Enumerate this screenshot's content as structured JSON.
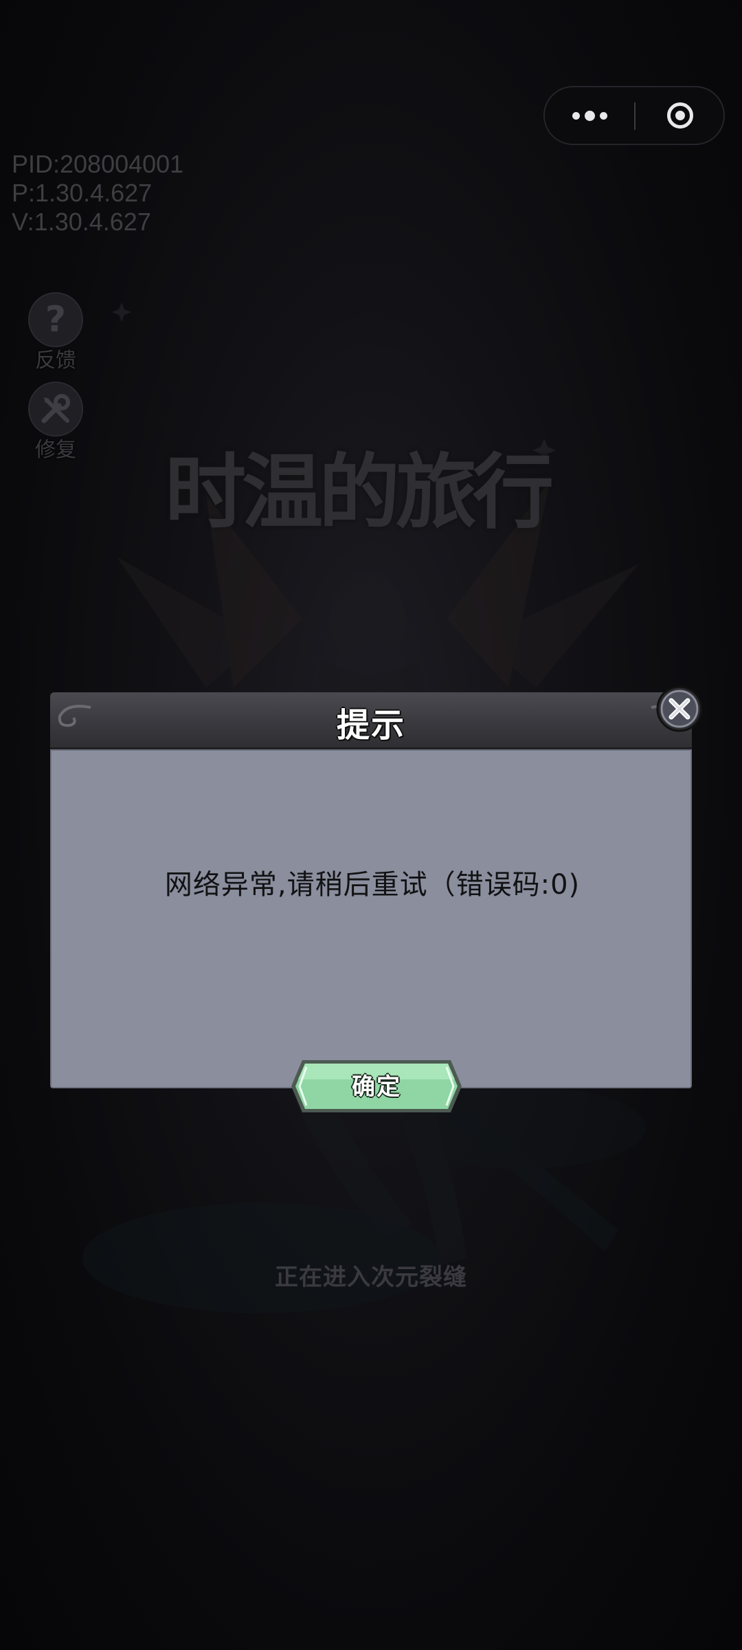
{
  "version_info": {
    "pid": "PID:208004001",
    "p": "P:1.30.4.627",
    "v": "V:1.30.4.627"
  },
  "side_buttons": {
    "feedback": {
      "icon": "question-icon",
      "glyph": "?",
      "label": "反馈"
    },
    "repair": {
      "icon": "wrench-screwdriver-icon",
      "label": "修复"
    }
  },
  "capsule": {
    "more_icon": "more-dots-icon",
    "close_icon": "target-circle-icon"
  },
  "background": {
    "game_title": "时温的旅行",
    "loading_text": "正在进入次元裂缝"
  },
  "dialog": {
    "title": "提示",
    "message": "网络异常,请稍后重试（错误码:0)",
    "confirm_label": "确定",
    "close_icon": "close-x-icon",
    "colors": {
      "header": "#38383d",
      "body": "#8a8e9d",
      "button": "#8fd6a4"
    }
  }
}
